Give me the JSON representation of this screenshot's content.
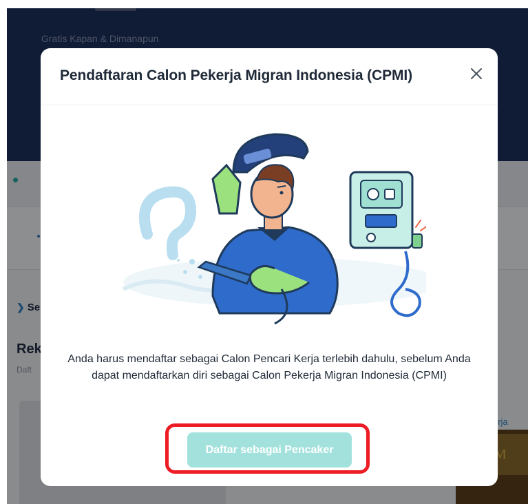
{
  "background": {
    "hero_tagline": "Gratis Kapan & Dimanapun",
    "section_label": "Se",
    "heading": "Rek",
    "subtext": "Daft",
    "link_text": "erja"
  },
  "modal": {
    "title": "Pendaftaran Calon Pekerja Migran Indonesia (CPMI)",
    "close_glyph": "✕",
    "message": "Anda harus mendaftar sebagai Calon Pencari Kerja terlebih dahulu, sebelum Anda dapat mendaftarkan diri sebagai Calon Pekerja Migran Indonesia (CPMI)",
    "cta_label": "Daftar sebagai Pencaker",
    "illustration_icon": "welder-illustration"
  },
  "colors": {
    "hero_navy": "#1c2f5c",
    "accent_teal": "#2aa9a1",
    "cta_disabled": "#a3e2dc",
    "highlight_red": "#ee1c25"
  }
}
